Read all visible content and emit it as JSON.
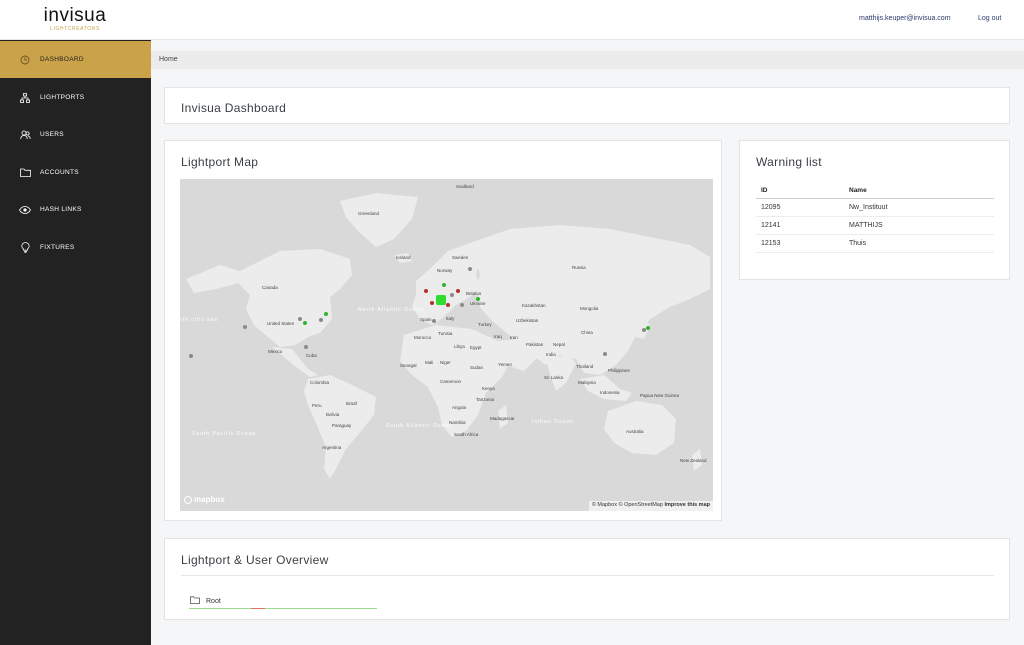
{
  "brand": {
    "name": "invisua",
    "tagline": "LIGHTCREATORS"
  },
  "header": {
    "user_email": "matthijs.keuper@invisua.com",
    "logout_label": "Log out"
  },
  "sidebar": {
    "items": [
      {
        "label": "DASHBOARD",
        "icon": "clock-icon",
        "active": true
      },
      {
        "label": "LIGHTPORTS",
        "icon": "network-icon",
        "active": false
      },
      {
        "label": "USERS",
        "icon": "users-icon",
        "active": false
      },
      {
        "label": "ACCOUNTS",
        "icon": "folder-icon",
        "active": false
      },
      {
        "label": "HASH LINKS",
        "icon": "eye-icon",
        "active": false
      },
      {
        "label": "FIXTURES",
        "icon": "lightbulb-icon",
        "active": false
      }
    ]
  },
  "breadcrumb": {
    "current": "Home"
  },
  "dashboard": {
    "title": "Invisua Dashboard"
  },
  "map_card": {
    "title": "Lightport Map",
    "labels": {
      "greenland": "Greenland",
      "iceland": "Iceland",
      "svalbard": "Svalbard",
      "sweden": "Sweden",
      "norway": "Norway",
      "russia": "Russia",
      "canada": "Canada",
      "united_states": "United States",
      "mexico": "Mexico",
      "cuba": "Cuba",
      "belarus": "Belarus",
      "ukraine": "Ukraine",
      "kazakhstan": "Kazakhstan",
      "mongolia": "Mongolia",
      "china": "China",
      "uzbekistan": "Uzbekistan",
      "turkey": "Turkey",
      "spain": "Spain",
      "italy": "Italy",
      "morocco": "Morocco",
      "tunisia": "Tunisia",
      "libya": "Libya",
      "egypt": "Egypt",
      "iraq": "Iraq",
      "iran": "Iran",
      "pakistan": "Pakistan",
      "nepal": "Nepal",
      "india": "India",
      "thailand": "Thailand",
      "philippines": "Philippines",
      "malaysia": "Malaysia",
      "indonesia": "Indonesia",
      "sri_lanka": "Sri Lanka",
      "yemen": "Yemen",
      "sudan": "Sudan",
      "mali": "Mali",
      "niger": "Niger",
      "senegal": "Senegal",
      "cameroon": "Cameroon",
      "kenya": "Kenya",
      "tanzania": "Tanzania",
      "angola": "Angola",
      "namibia": "Namibia",
      "madagascar": "Madagascar",
      "south_africa": "South Africa",
      "colombia": "Colombia",
      "peru": "Peru",
      "brazil": "Brazil",
      "bolivia": "Bolivia",
      "paraguay": "Paraguay",
      "argentina": "Argentina",
      "australia": "Australia",
      "new_zealand": "New Zealand",
      "papua": "Papua New Guinea",
      "north_atlantic": "North Atlantic Ocean",
      "south_atlantic": "South Atlantic Ocean",
      "indian_ocean": "Indian Ocean",
      "south_pacific": "South Pacific Ocean",
      "north_pacific_left": "rth cific ean"
    },
    "mapbox_logo": "mapbox",
    "attribution": "© Mapbox © OpenStreetMap",
    "improve_link": "Improve this map",
    "marker_colors": {
      "online": "#2fb52f",
      "offline": "#b52f2f",
      "unknown": "#8a8a8a"
    }
  },
  "warning_card": {
    "title": "Warning list",
    "columns": [
      "ID",
      "Name"
    ],
    "rows": [
      {
        "id": "12095",
        "name": "Nw_Instituut"
      },
      {
        "id": "12141",
        "name": "MATTHIJS"
      },
      {
        "id": "12153",
        "name": "Thuis"
      }
    ]
  },
  "overview_card": {
    "title": "Lightport & User Overview",
    "tree": [
      {
        "label": "Root",
        "icon": "folder-icon"
      }
    ]
  },
  "footer": {
    "left": "",
    "right": ""
  }
}
